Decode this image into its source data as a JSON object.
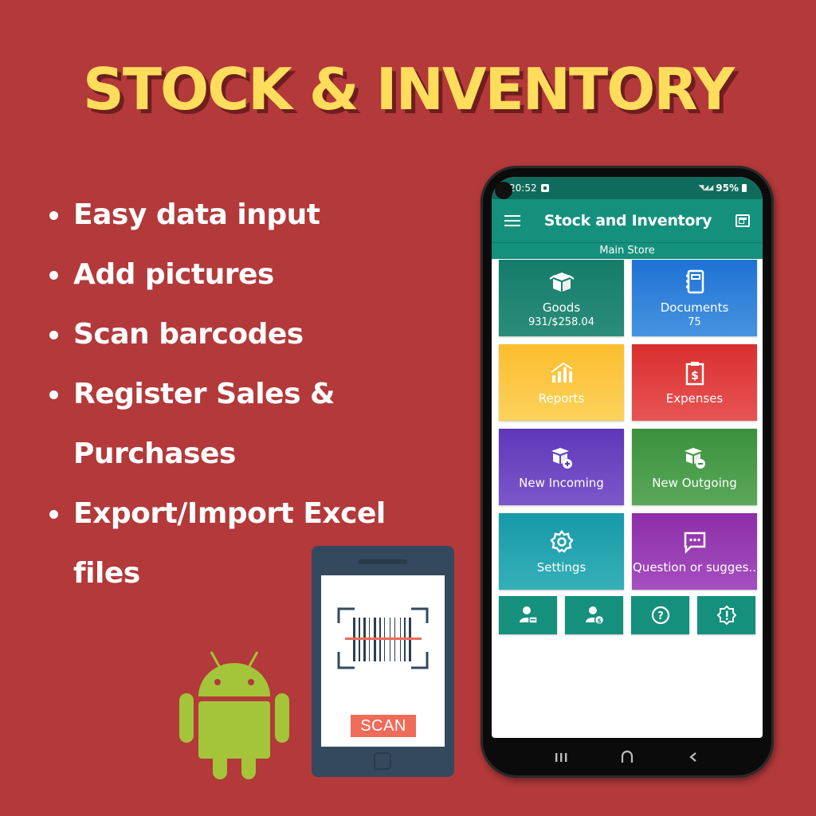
{
  "headline": "STOCK & INVENTORY",
  "features": [
    {
      "text": "Easy data input"
    },
    {
      "text": "Add pictures"
    },
    {
      "text": "Scan barcodes"
    },
    {
      "text": "Register Sales &",
      "continuation": "Purchases"
    },
    {
      "text": "Export/Import Excel",
      "continuation": "files"
    }
  ],
  "phone": {
    "status_bar": {
      "time": "20:52",
      "battery": "95%"
    },
    "app_bar": {
      "title": "Stock and Inventory",
      "menu_icon": "hamburger-menu-icon",
      "action_icon": "barcode-view-icon"
    },
    "store_name": "Main Store",
    "tiles": [
      {
        "label": "Goods",
        "sub": "931/$258.04",
        "icon": "open-box-icon",
        "color": "#157c6a"
      },
      {
        "label": "Documents",
        "sub": "75",
        "icon": "notebook-icon",
        "color": "#1f72d4"
      },
      {
        "label": "Reports",
        "sub": "",
        "icon": "bar-chart-icon",
        "color": "#fbbd2e"
      },
      {
        "label": "Expenses",
        "sub": "",
        "icon": "clipboard-dollar-icon",
        "color": "#d9302f"
      },
      {
        "label": "New Incoming",
        "sub": "",
        "icon": "box-plus-icon",
        "color": "#5e37ba"
      },
      {
        "label": "New Outgoing",
        "sub": "",
        "icon": "box-minus-icon",
        "color": "#3a913b"
      },
      {
        "label": "Settings",
        "sub": "",
        "icon": "gear-icon",
        "color": "#1799a8"
      },
      {
        "label": "Question or sugges...",
        "sub": "",
        "icon": "chat-bubble-icon",
        "color": "#8d2ea8"
      }
    ],
    "shortcuts": [
      {
        "icon": "user-box-icon"
      },
      {
        "icon": "user-dollar-icon"
      },
      {
        "icon": "help-circle-icon"
      },
      {
        "icon": "alert-badge-icon"
      }
    ],
    "nav": {
      "recent": "recent-apps-icon",
      "home": "home-icon",
      "back": "back-icon"
    }
  },
  "scanner_illustration": {
    "button_label": "SCAN"
  },
  "colors": {
    "background": "#b3393a",
    "headline": "#ffdd5c",
    "app_primary": "#15907d",
    "scan_accent": "#ef6b5a",
    "android_green": "#a4c439"
  }
}
